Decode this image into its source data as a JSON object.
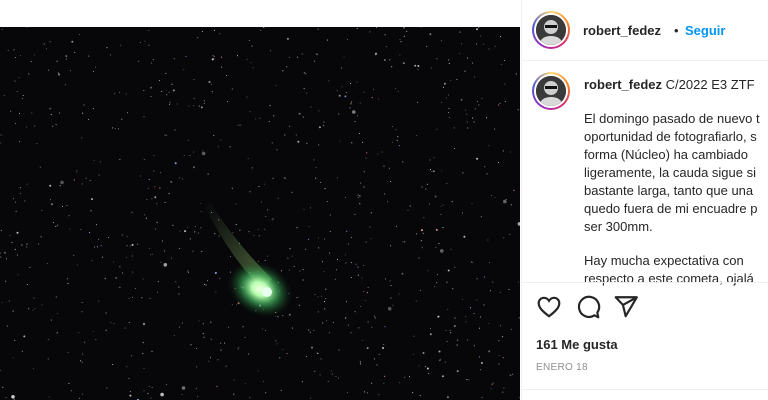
{
  "post": {
    "username": "robert_fedez",
    "follow_label": "Seguir",
    "separator": "•",
    "caption_title": "C/2022 E3 ZTF",
    "caption_paragraphs": [
      [
        "El domingo pasado de nuevo t",
        "oportunidad de fotografiarlo, s",
        "forma (Núcleo) ha cambiado",
        "ligeramente, la cauda sigue si",
        "bastante larga, tanto que una",
        "quedo fuera de mi encuadre p",
        "ser 300mm."
      ],
      [
        "Hay mucha expectativa con",
        "respecto a este cometa, ojalá"
      ]
    ],
    "likes": "161 Me gusta",
    "date": "ENERO 18"
  },
  "colors": {
    "accent": "#0095f6",
    "text": "#262626",
    "muted": "#8e8e8e",
    "photo_bg": "#07070a",
    "comet": "#7dff9a"
  },
  "icons": [
    "heart-icon",
    "comment-icon",
    "share-icon"
  ]
}
